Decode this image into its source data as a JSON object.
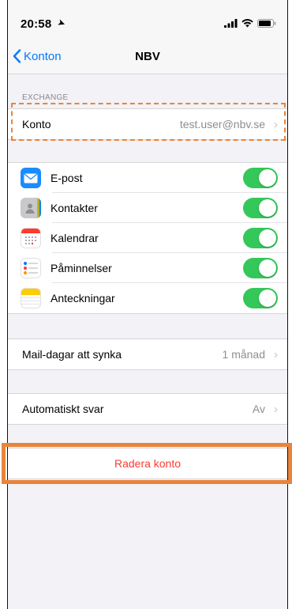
{
  "status_bar": {
    "time": "20:58"
  },
  "nav": {
    "back_label": "Konton",
    "title": "NBV"
  },
  "exchange": {
    "header": "EXCHANGE",
    "account_label": "Konto",
    "account_value": "test.user@nbv.se"
  },
  "services": [
    {
      "label": "E-post",
      "icon": "mail-icon",
      "enabled": true
    },
    {
      "label": "Kontakter",
      "icon": "contacts-icon",
      "enabled": true
    },
    {
      "label": "Kalendrar",
      "icon": "calendar-icon",
      "enabled": true
    },
    {
      "label": "Påminnelser",
      "icon": "reminders-icon",
      "enabled": true
    },
    {
      "label": "Anteckningar",
      "icon": "notes-icon",
      "enabled": true
    }
  ],
  "mail_days": {
    "label": "Mail-dagar att synka",
    "value": "1 månad"
  },
  "auto_reply": {
    "label": "Automatiskt svar",
    "value": "Av"
  },
  "delete": {
    "label": "Radera konto"
  },
  "colors": {
    "accent": "#007aff",
    "toggle_on": "#34c759",
    "destructive": "#ff3b30",
    "highlight": "#e8843c"
  }
}
